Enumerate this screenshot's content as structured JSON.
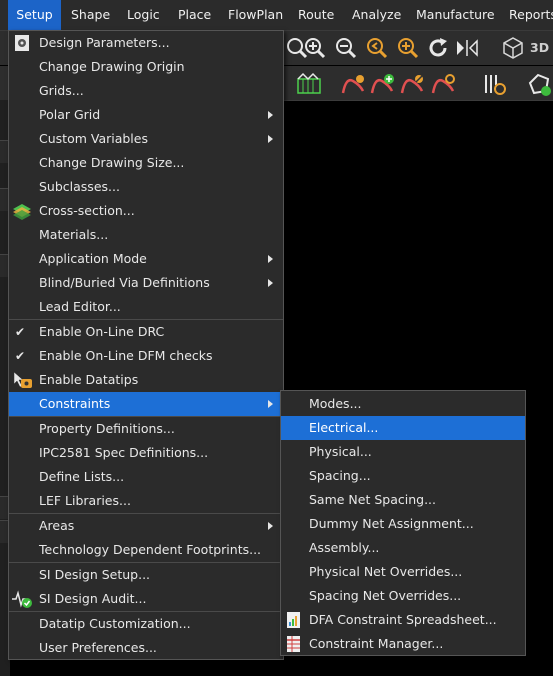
{
  "menubar": {
    "items": [
      "Setup",
      "Shape",
      "Logic",
      "Place",
      "FlowPlan",
      "Route",
      "Analyze",
      "Manufacture",
      "Reports"
    ],
    "active": "Setup"
  },
  "toolbar": {
    "label_3d": "3D"
  },
  "setup_menu": {
    "items": [
      {
        "label": "Design Parameters...",
        "submenu": false
      },
      {
        "label": "Change Drawing Origin",
        "submenu": false
      },
      {
        "label": "Grids...",
        "submenu": false
      },
      {
        "label": "Polar Grid",
        "submenu": true
      },
      {
        "label": "Custom Variables",
        "submenu": true
      },
      {
        "label": "Change Drawing Size...",
        "submenu": false
      },
      {
        "label": "Subclasses...",
        "submenu": false
      },
      {
        "label": "Cross-section...",
        "submenu": false
      },
      {
        "label": "Materials...",
        "submenu": false
      },
      {
        "label": "Application Mode",
        "submenu": true
      },
      {
        "label": "Blind/Buried Via Definitions",
        "submenu": true
      },
      {
        "label": "Lead Editor...",
        "submenu": false
      },
      {
        "label": "Enable On-Line DRC",
        "checked": true
      },
      {
        "label": "Enable On-Line DFM checks",
        "checked": true
      },
      {
        "label": "Enable Datatips",
        "submenu": false
      },
      {
        "label": "Constraints",
        "submenu": true,
        "highlighted": true
      },
      {
        "label": "Property Definitions...",
        "submenu": false
      },
      {
        "label": "IPC2581 Spec Definitions...",
        "submenu": false
      },
      {
        "label": "Define Lists...",
        "submenu": false
      },
      {
        "label": "LEF Libraries...",
        "submenu": false
      },
      {
        "label": "Areas",
        "submenu": true
      },
      {
        "label": "Technology Dependent Footprints...",
        "submenu": false
      },
      {
        "label": "SI Design Setup...",
        "submenu": false
      },
      {
        "label": "SI Design Audit...",
        "submenu": false
      },
      {
        "label": "Datatip Customization...",
        "submenu": false
      },
      {
        "label": "User Preferences...",
        "submenu": false
      }
    ]
  },
  "constraints_submenu": {
    "items": [
      {
        "label": "Modes..."
      },
      {
        "label": "Electrical...",
        "highlighted": true
      },
      {
        "label": "Physical..."
      },
      {
        "label": "Spacing..."
      },
      {
        "label": "Same Net Spacing..."
      },
      {
        "label": "Dummy Net Assignment..."
      },
      {
        "label": "Assembly..."
      },
      {
        "label": "Physical Net Overrides..."
      },
      {
        "label": "Spacing Net Overrides..."
      },
      {
        "label": "DFA Constraint Spreadsheet..."
      },
      {
        "label": "Constraint Manager..."
      }
    ]
  },
  "colors": {
    "highlight": "#1d6fd6",
    "menubar_active": "#1c64c8",
    "menu_bg": "#2b2b2b",
    "canvas_bg": "#000000"
  }
}
